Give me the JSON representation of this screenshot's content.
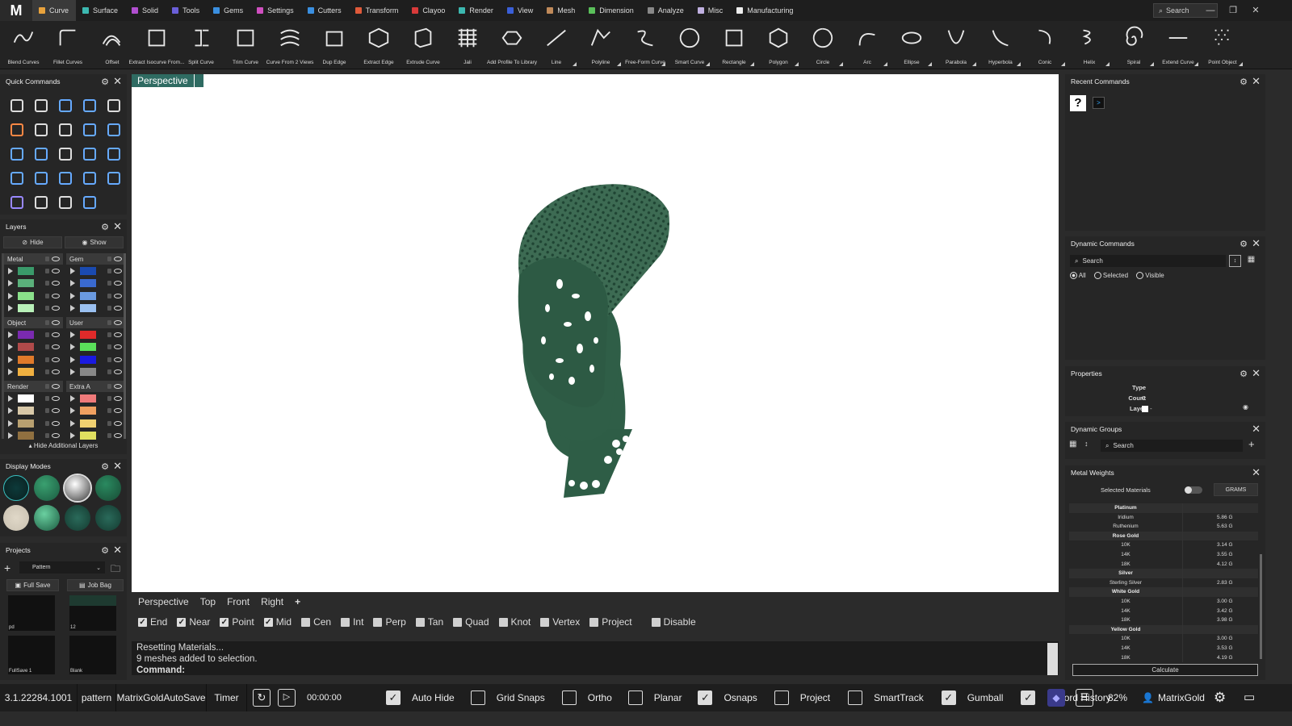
{
  "app": {
    "logo": "M",
    "search_label": "Search"
  },
  "menu_tabs": [
    {
      "label": "Curve",
      "color": "#e8a23c",
      "active": true
    },
    {
      "label": "Surface",
      "color": "#3cb8b0"
    },
    {
      "label": "Solid",
      "color": "#b14fd0"
    },
    {
      "label": "Tools",
      "color": "#6a5fd8"
    },
    {
      "label": "Gems",
      "color": "#3a8fe0"
    },
    {
      "label": "Settings",
      "color": "#d04fc0"
    },
    {
      "label": "Cutters",
      "color": "#3a8fe0"
    },
    {
      "label": "Transform",
      "color": "#e05a3a"
    },
    {
      "label": "Clayoo",
      "color": "#d83a3a"
    },
    {
      "label": "Render",
      "color": "#3cb8b0"
    },
    {
      "label": "View",
      "color": "#3a5fd8"
    },
    {
      "label": "Mesh",
      "color": "#c08a5a"
    },
    {
      "label": "Dimension",
      "color": "#5ac05a"
    },
    {
      "label": "Analyze",
      "color": "#888888"
    },
    {
      "label": "Misc",
      "color": "#c0b0e0"
    },
    {
      "label": "Manufacturing",
      "color": "#eeeeee"
    }
  ],
  "toolbar": [
    {
      "label": "Blend Curves",
      "icon": "blend-curves-icon",
      "menu": false
    },
    {
      "label": "Fillet Curves",
      "icon": "fillet-curves-icon",
      "menu": false
    },
    {
      "label": "Offset",
      "icon": "offset-icon",
      "menu": false
    },
    {
      "label": "Extract Isocurve From...",
      "icon": "extract-isocurve-icon",
      "menu": false
    },
    {
      "label": "Split Curve",
      "icon": "split-curve-icon",
      "menu": false
    },
    {
      "label": "Trim Curve",
      "icon": "trim-curve-icon",
      "menu": false
    },
    {
      "label": "Curve From 2 Views",
      "icon": "curve-from-2-views-icon",
      "menu": false
    },
    {
      "label": "Dup Edge",
      "icon": "dup-edge-icon",
      "menu": false
    },
    {
      "label": "Extract Edge",
      "icon": "extract-edge-icon",
      "menu": false
    },
    {
      "label": "Extrude Curve",
      "icon": "extrude-curve-icon",
      "menu": false
    },
    {
      "label": "Jali",
      "icon": "jali-icon",
      "menu": false
    },
    {
      "label": "Add Profile To Library",
      "icon": "add-profile-icon",
      "menu": false
    },
    {
      "label": "Line",
      "icon": "line-icon",
      "menu": true
    },
    {
      "label": "Polyline",
      "icon": "polyline-icon",
      "menu": true
    },
    {
      "label": "Free-Form Curve",
      "icon": "free-form-curve-icon",
      "menu": true
    },
    {
      "label": "Smart Curve",
      "icon": "smart-curve-icon",
      "menu": true
    },
    {
      "label": "Rectangle",
      "icon": "rectangle-icon",
      "menu": true
    },
    {
      "label": "Polygon",
      "icon": "polygon-icon",
      "menu": true
    },
    {
      "label": "Circle",
      "icon": "circle-icon",
      "menu": true
    },
    {
      "label": "Arc",
      "icon": "arc-icon",
      "menu": true
    },
    {
      "label": "Ellipse",
      "icon": "ellipse-icon",
      "menu": true
    },
    {
      "label": "Parabola",
      "icon": "parabola-icon",
      "menu": true
    },
    {
      "label": "Hyperbola",
      "icon": "hyperbola-icon",
      "menu": true
    },
    {
      "label": "Conic",
      "icon": "conic-icon",
      "menu": true
    },
    {
      "label": "Helix",
      "icon": "helix-icon",
      "menu": true
    },
    {
      "label": "Spiral",
      "icon": "spiral-icon",
      "menu": true
    },
    {
      "label": "Extend Curve",
      "icon": "extend-curve-icon",
      "menu": true
    },
    {
      "label": "Point Object",
      "icon": "point-object-icon",
      "menu": true
    }
  ],
  "quick_commands": {
    "title": "Quick Commands"
  },
  "layers": {
    "title": "Layers",
    "hide_label": "Hide",
    "show_label": "Show",
    "groups": [
      {
        "name": "Metal",
        "colors": [
          "#3a9a6a",
          "#5ab07a",
          "#8ae08a",
          "#b8f0b8"
        ]
      },
      {
        "name": "Gem",
        "colors": [
          "#1a4ab0",
          "#3a6ad0",
          "#6a9ae0",
          "#9ac0f0"
        ]
      },
      {
        "name": "Object",
        "colors": [
          "#7a2ab0",
          "#b04a4a",
          "#e07a2a",
          "#f0b040"
        ]
      },
      {
        "name": "User",
        "colors": [
          "#e02a2a",
          "#5ae05a",
          "#1a1ae0",
          "#888888"
        ]
      },
      {
        "name": "Render",
        "colors": [
          "#ffffff",
          "#d8c8a8",
          "#b8a070",
          "#907040"
        ]
      },
      {
        "name": "Extra A",
        "colors": [
          "#f07a7a",
          "#f0a060",
          "#f0d070",
          "#e0e060"
        ]
      }
    ],
    "hide_additional": "Hide Additional Layers"
  },
  "display_modes": {
    "title": "Display Modes"
  },
  "projects": {
    "title": "Projects",
    "selected": "Pattern",
    "full_save": "Full Save",
    "job_bag": "Job Bag",
    "tiles": [
      "pd",
      "12",
      "FullSave 1",
      "Blank"
    ]
  },
  "viewport": {
    "active_label": "Perspective",
    "tabs": [
      "Perspective",
      "Top",
      "Front",
      "Right"
    ],
    "add_tab": "+"
  },
  "snaps": [
    {
      "label": "End",
      "checked": true
    },
    {
      "label": "Near",
      "checked": true
    },
    {
      "label": "Point",
      "checked": true
    },
    {
      "label": "Mid",
      "checked": true
    },
    {
      "label": "Cen",
      "checked": false
    },
    {
      "label": "Int",
      "checked": false
    },
    {
      "label": "Perp",
      "checked": false
    },
    {
      "label": "Tan",
      "checked": false
    },
    {
      "label": "Quad",
      "checked": false
    },
    {
      "label": "Knot",
      "checked": false
    },
    {
      "label": "Vertex",
      "checked": false
    },
    {
      "label": "Project",
      "checked": false
    },
    {
      "label": "Disable",
      "checked": false
    }
  ],
  "command_log": {
    "line1": "Resetting Materials...",
    "line2": "9 meshes added to selection.",
    "prompt": "Command:"
  },
  "status": {
    "version": "3.1.22284.1001",
    "project": "pattern",
    "autosave": "MatrixGoldAutoSave",
    "timer_label": "Timer",
    "timer_value": "00:00:00",
    "toggles": [
      {
        "label": "Auto Hide",
        "checked": true
      },
      {
        "label": "Grid Snaps",
        "checked": false
      },
      {
        "label": "Ortho",
        "checked": false
      },
      {
        "label": "Planar",
        "checked": false
      },
      {
        "label": "Osnaps",
        "checked": true
      },
      {
        "label": "Project",
        "checked": false
      },
      {
        "label": "SmartTrack",
        "checked": false
      },
      {
        "label": "Gumball",
        "checked": true
      },
      {
        "label": "Record History",
        "checked": true
      }
    ],
    "zoom": "82%",
    "user": "MatrixGold"
  },
  "recent_commands": {
    "title": "Recent Commands"
  },
  "dynamic_commands": {
    "title": "Dynamic Commands",
    "search": "Search",
    "filters": [
      "All",
      "Selected",
      "Visible"
    ]
  },
  "properties": {
    "title": "Properties",
    "type_label": "Type",
    "type_value": "-",
    "count_label": "Count",
    "count_value": "0",
    "layer_label": "Layer",
    "layer_value": "-"
  },
  "dynamic_groups": {
    "title": "Dynamic Groups",
    "search": "Search"
  },
  "metal_weights": {
    "title": "Metal Weights",
    "selected_materials": "Selected Materials",
    "unit": "GRAMS",
    "calculate": "Calculate",
    "rows": [
      {
        "type": "head",
        "name": "Platinum"
      },
      {
        "name": "Iridium",
        "value": "5.86 G"
      },
      {
        "name": "Ruthenium",
        "value": "5.63 G"
      },
      {
        "type": "head",
        "name": "Rose Gold"
      },
      {
        "name": "10K",
        "value": "3.14 G"
      },
      {
        "name": "14K",
        "value": "3.55 G"
      },
      {
        "name": "18K",
        "value": "4.12 G"
      },
      {
        "type": "head",
        "name": "Silver"
      },
      {
        "name": "Sterling Silver",
        "value": "2.83 G"
      },
      {
        "type": "head",
        "name": "White Gold"
      },
      {
        "name": "10K",
        "value": "3.00 G"
      },
      {
        "name": "14K",
        "value": "3.42 G"
      },
      {
        "name": "18K",
        "value": "3.98 G"
      },
      {
        "type": "head",
        "name": "Yellow Gold"
      },
      {
        "name": "10K",
        "value": "3.00 G"
      },
      {
        "name": "14K",
        "value": "3.53 G"
      },
      {
        "name": "18K",
        "value": "4.19 G"
      }
    ]
  }
}
